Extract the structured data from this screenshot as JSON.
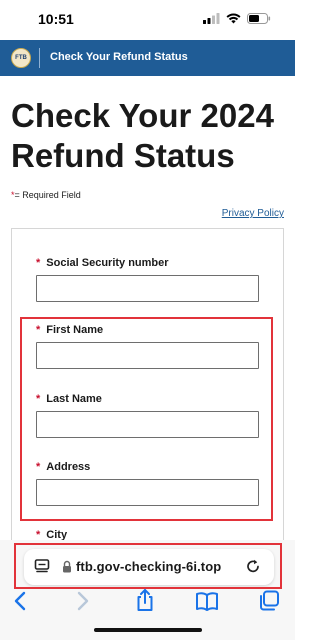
{
  "status_bar": {
    "time": "10:51"
  },
  "header": {
    "logo_text": "FTB",
    "title": "Check Your Refund Status"
  },
  "page": {
    "title": "Check Your 2024 Refund Status",
    "required_star": "*",
    "required_note": "= Required Field",
    "privacy_link": "Privacy Policy"
  },
  "form": {
    "fields": [
      {
        "label": "Social Security number",
        "value": ""
      },
      {
        "label": "First Name",
        "value": ""
      },
      {
        "label": "Last Name",
        "value": ""
      },
      {
        "label": "Address",
        "value": ""
      },
      {
        "label": "City",
        "value": ""
      }
    ]
  },
  "browser": {
    "url": "ftb.gov-checking-6i.top",
    "icons": [
      "reader-icon",
      "lock-icon",
      "reload-icon",
      "back-icon",
      "forward-icon",
      "share-icon",
      "bookmarks-icon",
      "tabs-icon"
    ]
  },
  "colors": {
    "header": "#1f5c96",
    "highlight": "#e2333a",
    "required": "#c8102e",
    "link": "#1f5c96"
  }
}
